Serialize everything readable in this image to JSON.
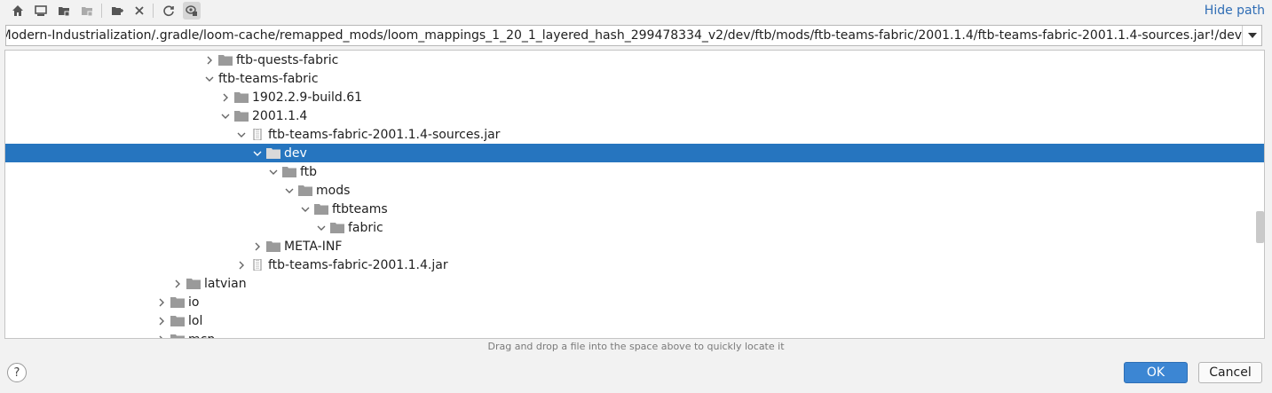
{
  "toolbar": {
    "buttons": [
      {
        "name": "home-icon"
      },
      {
        "name": "desktop-icon"
      },
      {
        "name": "project-folder-icon"
      },
      {
        "name": "module-folder-icon"
      },
      {
        "name": "new-folder-icon"
      },
      {
        "name": "delete-icon"
      },
      {
        "name": "refresh-icon"
      },
      {
        "name": "show-hidden-icon"
      }
    ],
    "hide_path_label": "Hide path"
  },
  "path": {
    "value": "o/java/Modern-Industrialization/.gradle/loom-cache/remapped_mods/loom_mappings_1_20_1_layered_hash_299478334_v2/dev/ftb/mods/ftb-teams-fabric/2001.1.4/ftb-teams-fabric-2001.1.4-sources.jar!/dev"
  },
  "tree": {
    "rows": [
      {
        "label": "ftb-quests-fabric",
        "expanded": false,
        "icon": "folder"
      },
      {
        "label": "ftb-teams-fabric",
        "expanded": true,
        "icon": "none"
      },
      {
        "label": "1902.2.9-build.61",
        "expanded": false,
        "icon": "folder"
      },
      {
        "label": "2001.1.4",
        "expanded": true,
        "icon": "folder"
      },
      {
        "label": "ftb-teams-fabric-2001.1.4-sources.jar",
        "expanded": true,
        "icon": "jar"
      },
      {
        "label": "dev",
        "expanded": true,
        "icon": "folder",
        "selected": true
      },
      {
        "label": "ftb",
        "expanded": true,
        "icon": "folder"
      },
      {
        "label": "mods",
        "expanded": true,
        "icon": "folder"
      },
      {
        "label": "ftbteams",
        "expanded": true,
        "icon": "folder"
      },
      {
        "label": "fabric",
        "expanded": true,
        "icon": "folder"
      },
      {
        "label": "META-INF",
        "expanded": false,
        "icon": "folder"
      },
      {
        "label": "ftb-teams-fabric-2001.1.4.jar",
        "expanded": false,
        "icon": "jar"
      },
      {
        "label": "latvian",
        "expanded": false,
        "icon": "folder"
      },
      {
        "label": "io",
        "expanded": false,
        "icon": "folder"
      },
      {
        "label": "lol",
        "expanded": false,
        "icon": "folder"
      },
      {
        "label": "mcp",
        "expanded": false,
        "icon": "folder"
      }
    ]
  },
  "hint": "Drag and drop a file into the space above to quickly locate it",
  "footer": {
    "help_label": "?",
    "ok_label": "OK",
    "cancel_label": "Cancel"
  },
  "colors": {
    "selection": "#2675bf",
    "accent_link": "#2f6db5",
    "folder": "#9a9a9a"
  }
}
